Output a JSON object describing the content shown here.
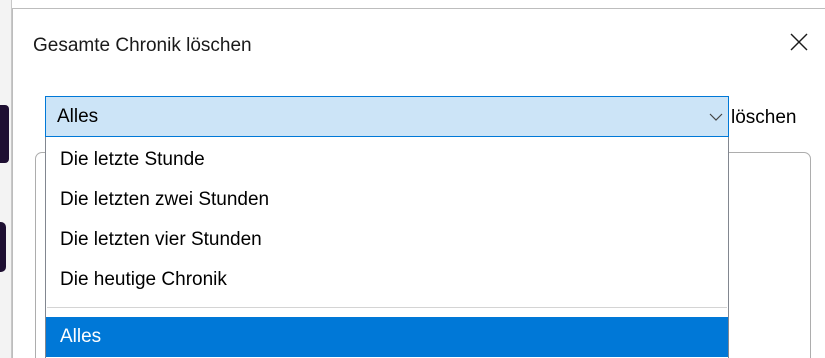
{
  "dialog": {
    "title": "Gesamte Chronik löschen",
    "close_icon": "close-icon"
  },
  "time_range": {
    "selected": "Alles",
    "trailing_label": "löschen",
    "arrow_icon": "chevron-down-icon",
    "options": [
      "Die letzte Stunde",
      "Die letzten zwei Stunden",
      "Die letzten vier Stunden",
      "Die heutige Chronik",
      "Alles"
    ],
    "selected_index": 4
  },
  "colors": {
    "accent": "#0078d7",
    "select_background": "#cce4f7",
    "background_app": "#1e0f32"
  }
}
